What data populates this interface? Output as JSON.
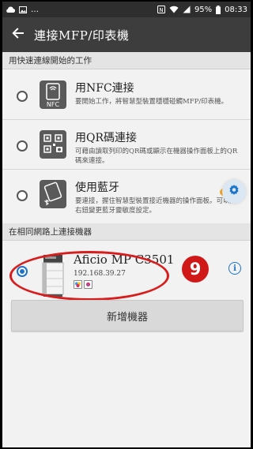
{
  "status_bar": {
    "left_icons": [
      "cloud-icon",
      "image-icon",
      "more-icon"
    ],
    "right_icons": [
      "nfc-icon",
      "wifi-icon",
      "signal-icon",
      "battery-icon"
    ],
    "battery": "95%",
    "time": "08:33"
  },
  "app_bar": {
    "title": "連接MFP/印表機"
  },
  "sections": {
    "quick_connect": "用快速連線開始的工作",
    "network": "在相同網路上連接機器"
  },
  "options": [
    {
      "title": "用NFC連接",
      "icon_label": "NFC",
      "description": "要開始工作，將智慧型裝置穩穩碰觸MFP/印表機。"
    },
    {
      "title": "用QR碼連接",
      "description": "可藉由讀取列印的QR碼或顯示在機器操作面板上的QR碼來連接。"
    },
    {
      "title": "使用藍牙",
      "description": "要連接，握住智慧型裝置接近機器的操作面板。可以用右鈕變更藍牙靈敏度設定。"
    }
  ],
  "printer": {
    "name": "Aficio MP C3501",
    "ip": "192.168.39.27",
    "selected": true
  },
  "step_number": "9",
  "add_button": "新增機器",
  "colors": {
    "highlight": "#d91c1c",
    "accent": "#1a73c8",
    "appbar": "#3d3d3d"
  }
}
